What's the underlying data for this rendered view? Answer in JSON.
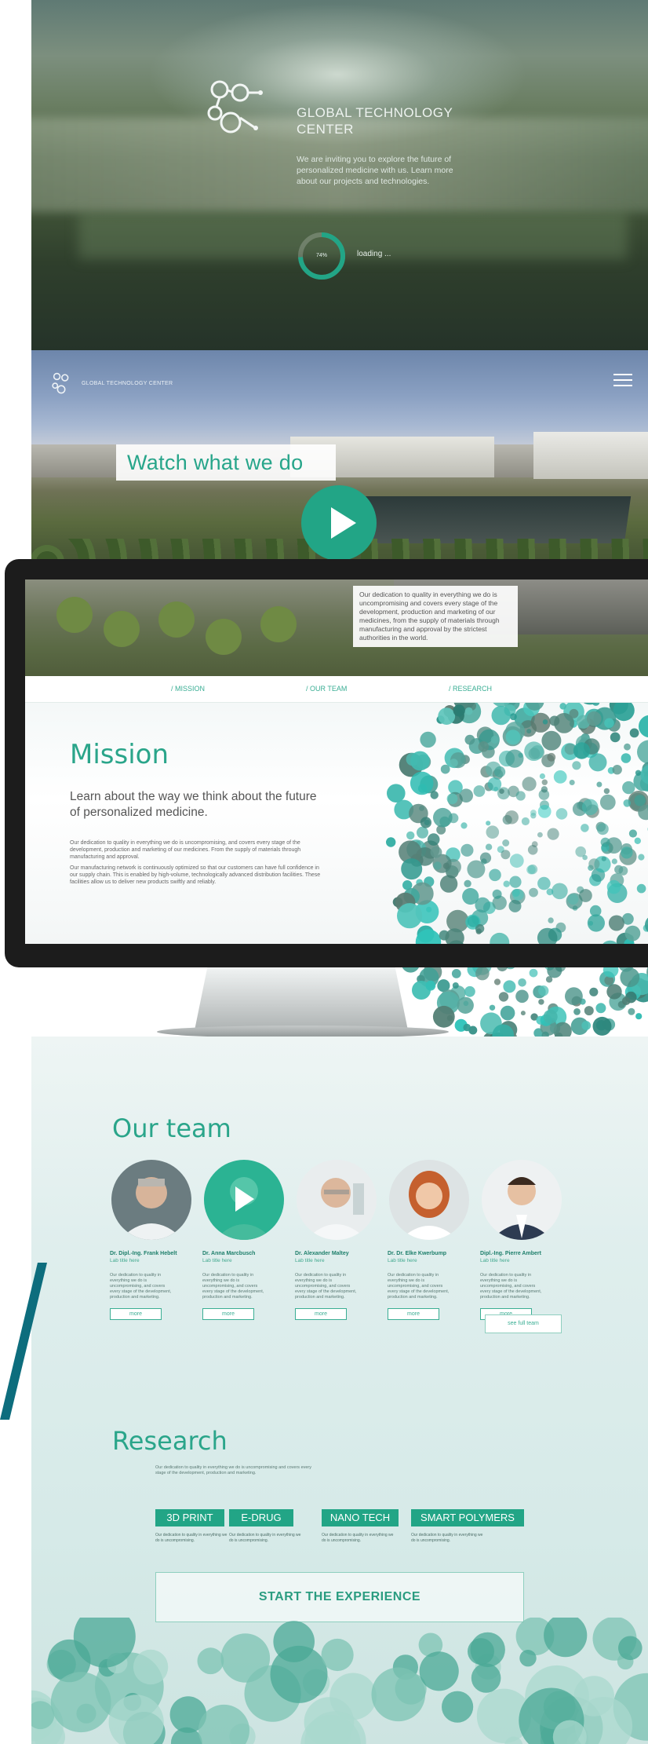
{
  "loading_screen": {
    "title": "GLOBAL TECHNOLOGY CENTER",
    "intro": "We are inviting you to explore the future of personalized medicine with us. Learn more about our projects and technologies.",
    "progress_label": "74%",
    "progress": 0.74,
    "status": "loading ..."
  },
  "video_hero": {
    "brand_small": "GLOBAL TECHNOLOGY CENTER",
    "headline": "Watch what we do",
    "menu_icon": "hamburger-icon",
    "play_icon": "play-icon"
  },
  "site": {
    "caption": "Our dedication to quality in everything we do is uncompromising and covers every stage of the development, production and marketing of our medicines, from the supply of materials through manufacturing and approval by the strictest authorities in the world.",
    "nav": [
      "/ MISSION",
      "/ OUR TEAM",
      "/ RESEARCH"
    ],
    "mission": {
      "title": "Mission",
      "lead": "Learn about the way we think about the future of personalized medicine.",
      "body1": "Our dedication to quality in everything we do is uncompromising, and covers every stage of the development, production and marketing of our medicines. From the supply of materials through manufacturing and approval.",
      "body2": "Our manufacturing network is continuously optimized so that our customers can have full confidence in our supply chain. This is enabled by high-volume, technologically advanced distribution facilities. These facilities allow us to deliver new products swiftly and reliably."
    }
  },
  "team": {
    "title": "Our team",
    "members": [
      {
        "name": "Dr. Dipl.-Ing. Frank Hebelt",
        "role": "Lab title here",
        "desc": "Our dedication to quality in everything we do is uncompromising, and covers every stage of the development, production and marketing.",
        "more": "more"
      },
      {
        "name": "Dr. Anna Marcbusch",
        "role": "Lab title here",
        "desc": "Our dedication to quality in everything we do is uncompromising, and covers every stage of the development, production and marketing.",
        "more": "more"
      },
      {
        "name": "Dr. Alexander Maltey",
        "role": "Lab title here",
        "desc": "Our dedication to quality in everything we do is uncompromising, and covers every stage of the development, production and marketing.",
        "more": "more"
      },
      {
        "name": "Dr. Dr. Elke Kwerbump",
        "role": "Lab title here",
        "desc": "Our dedication to quality in everything we do is uncompromising, and covers every stage of the development, production and marketing.",
        "more": "more"
      },
      {
        "name": "Dipl.-Ing. Pierre Ambert",
        "role": "Lab title here",
        "desc": "Our dedication to quality in everything we do is uncompromising, and covers every stage of the development, production and marketing.",
        "more": "more"
      }
    ],
    "see_full": "see full team"
  },
  "research": {
    "title": "Research",
    "intro": "Our dedication to quality in everything we do is uncompromising and covers every stage of the development, production and marketing.",
    "tags": [
      {
        "label": "3D PRINT",
        "desc": "Our dedication to quality in everything we do is uncompromising."
      },
      {
        "label": "E-DRUG",
        "desc": "Our dedication to quality in everything we do is uncompromising."
      },
      {
        "label": "NANO TECH",
        "desc": "Our dedication to quality in everything we do is uncompromising."
      },
      {
        "label": "SMART POLYMERS",
        "desc": "Our dedication to quality in everything we do is uncompromising."
      }
    ],
    "cta": "START THE EXPERIENCE"
  },
  "colors": {
    "accent": "#22a586",
    "accent_text": "#2aa58a",
    "bezel": "#1c1c1c",
    "slash": "#0d6d7d"
  }
}
